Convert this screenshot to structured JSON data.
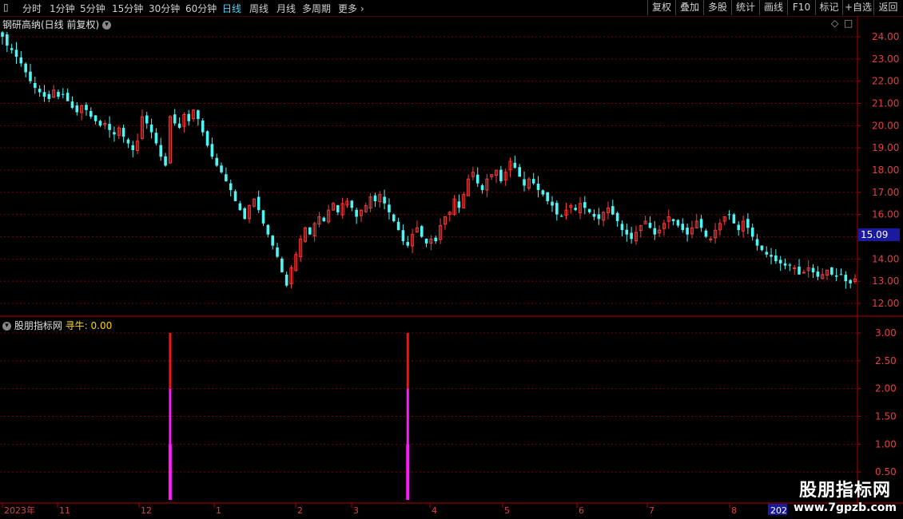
{
  "toolbar": {
    "periods": [
      "分时",
      "1分钟",
      "5分钟",
      "15分钟",
      "30分钟",
      "60分钟",
      "日线",
      "周线",
      "月线",
      "多周期",
      "更多"
    ],
    "active_period": "日线",
    "right_buttons": [
      "复权",
      "叠加",
      "多股",
      "统计",
      "画线",
      "F10",
      "标记",
      "+自选",
      "返回"
    ]
  },
  "stock": {
    "title": "钢研高纳(日线 前复权)"
  },
  "indicator": {
    "source": "股朋指标网",
    "label": "寻牛:",
    "value": "0.00"
  },
  "watermark": {
    "cn": "股朋指标网",
    "url": "www.7gpzb.com"
  },
  "colors": {
    "up": "#ff3b3b",
    "down": "#4ff4f4",
    "grid": "#7a0000",
    "axis": "#b00000",
    "price_tag_bg": "#1a1aa0",
    "signal_top": "#ff1010",
    "signal_bottom": "#ff1aff"
  },
  "chart_data": [
    {
      "type": "candlestick",
      "title": "钢研高纳(日线 前复权)",
      "y_ticks": [
        "24.00",
        "23.00",
        "22.00",
        "21.00",
        "20.00",
        "19.00",
        "18.00",
        "17.00",
        "16.00",
        "15.00",
        "14.00",
        "13.00",
        "12.00"
      ],
      "ylim": [
        11.8,
        24.3
      ],
      "current_price": "15.09",
      "x_ticks": [
        "2023年",
        "11",
        "12",
        "1",
        "2",
        "3",
        "4",
        "5",
        "6",
        "7",
        "8",
        "202"
      ],
      "closes": [
        24.0,
        23.6,
        23.4,
        23.1,
        22.8,
        22.4,
        22.0,
        21.7,
        21.5,
        21.3,
        21.2,
        21.6,
        21.3,
        21.4,
        21.1,
        20.8,
        20.6,
        20.9,
        20.7,
        20.4,
        20.2,
        20.0,
        20.1,
        19.8,
        19.6,
        19.9,
        19.5,
        19.2,
        18.9,
        19.3,
        20.4,
        20.1,
        19.7,
        19.2,
        18.6,
        18.2,
        20.4,
        20.1,
        19.9,
        20.5,
        20.2,
        20.7,
        20.3,
        19.7,
        19.1,
        18.6,
        18.2,
        17.9,
        17.5,
        17.1,
        16.6,
        16.2,
        15.8,
        16.4,
        16.7,
        16.2,
        15.6,
        15.1,
        14.6,
        14.1,
        13.4,
        12.8,
        13.6,
        14.2,
        14.9,
        15.4,
        15.1,
        15.6,
        15.9,
        15.7,
        16.2,
        16.5,
        16.1,
        16.5,
        16.6,
        16.3,
        15.9,
        16.2,
        16.4,
        16.8,
        16.6,
        16.9,
        16.5,
        16.1,
        15.7,
        15.3,
        14.8,
        14.6,
        15.1,
        15.4,
        15.0,
        14.7,
        14.9,
        14.8,
        15.5,
        15.9,
        16.1,
        16.7,
        16.3,
        16.9,
        17.6,
        17.9,
        17.4,
        17.1,
        17.6,
        17.8,
        18.0,
        17.5,
        17.9,
        18.4,
        18.1,
        17.7,
        17.3,
        17.6,
        17.4,
        17.1,
        16.9,
        16.6,
        16.4,
        16.0,
        15.9,
        16.2,
        16.4,
        16.2,
        16.5,
        16.3,
        16.1,
        15.9,
        15.8,
        16.1,
        16.3,
        16.0,
        15.7,
        15.3,
        15.1,
        14.9,
        15.2,
        15.5,
        15.7,
        15.4,
        15.1,
        15.3,
        15.6,
        15.9,
        15.7,
        15.5,
        15.3,
        15.1,
        15.4,
        15.7,
        15.4,
        15.0,
        14.9,
        15.3,
        15.6,
        15.9,
        16.0,
        15.6,
        15.3,
        15.7,
        15.4,
        15.0,
        14.6,
        14.4,
        14.2,
        14.1,
        13.9,
        13.8,
        13.7,
        13.7,
        13.6,
        13.3,
        13.4,
        13.6,
        13.4,
        13.2,
        13.3,
        13.5,
        13.3,
        13.2,
        13.3,
        13.0,
        12.9,
        13.1
      ],
      "indicator": {
        "name": "寻牛",
        "y_ticks": [
          "3.00",
          "2.50",
          "2.00",
          "1.50",
          "1.00",
          "0.50"
        ],
        "ylim": [
          0,
          3.2
        ],
        "signals": [
          {
            "bar_index": 36,
            "segments": [
              {
                "from": 0,
                "to": 1,
                "color": "#ff1aff"
              },
              {
                "from": 1,
                "to": 2,
                "color": "#ff1aff"
              },
              {
                "from": 2,
                "to": 3,
                "color": "#ff1010"
              }
            ]
          },
          {
            "bar_index": 87,
            "segments": [
              {
                "from": 0,
                "to": 1,
                "color": "#ff1aff"
              },
              {
                "from": 1,
                "to": 2,
                "color": "#ff1aff"
              },
              {
                "from": 2,
                "to": 3,
                "color": "#ff1010"
              }
            ]
          }
        ]
      }
    }
  ]
}
